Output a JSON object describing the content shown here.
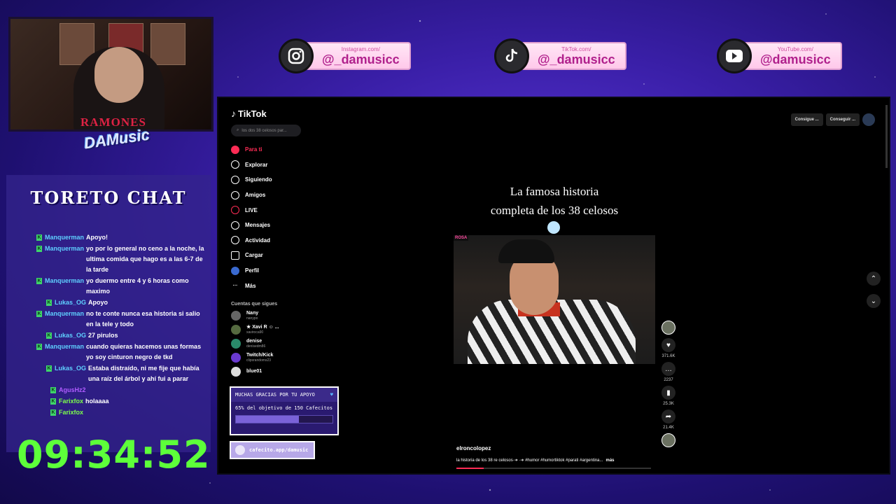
{
  "webcam": {
    "shirt_text": "RAMONES"
  },
  "brand_logo": "DAMusic",
  "socials": [
    {
      "icon": "instagram-icon",
      "site": "Instagram.com/",
      "handle": "@_damusicc"
    },
    {
      "icon": "tiktok-icon",
      "site": "TikTok.com/",
      "handle": "@_damusicc"
    },
    {
      "icon": "youtube-icon",
      "site": "YouTube.com/",
      "handle": "@damusicc"
    }
  ],
  "chat": {
    "title": "TORETO CHAT",
    "messages": [
      {
        "user": "Manquerman",
        "text": "Apoyo!"
      },
      {
        "user": "Manquerman",
        "text": "yo por lo general no ceno a la noche, la ultima comida que hago es a las 6-7 de la tarde"
      },
      {
        "user": "Manquerman",
        "text": "yo duermo entre 4 y 6 horas como maximo"
      },
      {
        "user": "Lukas_OG",
        "text": "Apoyo"
      },
      {
        "user": "Manquerman",
        "text": "no te conte nunca esa historia si salio en la tele y todo"
      },
      {
        "user": "Lukas_OG",
        "text": "27 pirulos"
      },
      {
        "user": "Manquerman",
        "text": "cuando quieras hacemos unas formas yo soy cinturon negro de tkd"
      },
      {
        "user": "Lukas_OG",
        "text": "Estaba distraído, ni me fije que había una raíz del árbol y ahí fui a parar"
      },
      {
        "user": "AgusHz2",
        "text": ""
      },
      {
        "user": "Farixfox",
        "text": "holaaaa"
      },
      {
        "user": "Farixfox",
        "text": ""
      }
    ]
  },
  "clock": "09:34:52",
  "tiktok": {
    "logo": "TikTok",
    "search_placeholder": "los dos 38 celosos par...",
    "nav": [
      {
        "label": "Para ti",
        "icon": "home-icon",
        "active": true
      },
      {
        "label": "Explorar",
        "icon": "compass-icon"
      },
      {
        "label": "Siguiendo",
        "icon": "following-icon"
      },
      {
        "label": "Amigos",
        "icon": "friends-icon"
      },
      {
        "label": "LIVE",
        "icon": "live-icon"
      },
      {
        "label": "Mensajes",
        "icon": "messages-icon"
      },
      {
        "label": "Actividad",
        "icon": "activity-icon"
      },
      {
        "label": "Cargar",
        "icon": "upload-icon"
      },
      {
        "label": "Perfil",
        "icon": "profile-icon"
      },
      {
        "label": "Más",
        "icon": "more-icon"
      }
    ],
    "following_header": "Cuentas que sigues",
    "following": [
      {
        "name": "Nany",
        "user": "nanypo"
      },
      {
        "name": "★ Xavi R ☺ ...",
        "user": "xaviroca90"
      },
      {
        "name": "denise",
        "user": "denisedm86"
      },
      {
        "name": "Twitch/Kick",
        "user": "clipsrandoms23"
      },
      {
        "name": "blue01",
        "user": ""
      }
    ],
    "top_buttons": [
      "Consigue ...",
      "Conseguir ..."
    ],
    "video_title_line1": "La famosa historia",
    "video_title_line2": "completa de los 38 celosos",
    "video_tag": "ROSA",
    "counts": {
      "likes": "371.6K",
      "comments": "2237",
      "saves": "25.3K",
      "shares": "21.4K"
    },
    "author": "elroncolopez",
    "description": "la historia de los 38 re celosos·➜ ·➜ #humor #humortiktok #parati #argentina...",
    "more": "más",
    "progress": 0.14
  },
  "donation": {
    "title": "MUCHAS GRACIAS POR TU APOYO",
    "goal_text": "65% del objetivo de 150 Cafecitos",
    "progress": 0.65,
    "link": "cafecito.app/damusic"
  },
  "colors": {
    "accent": "#fe2c55",
    "clock": "#5dff3a",
    "chat_user": "#5fd0ff"
  }
}
